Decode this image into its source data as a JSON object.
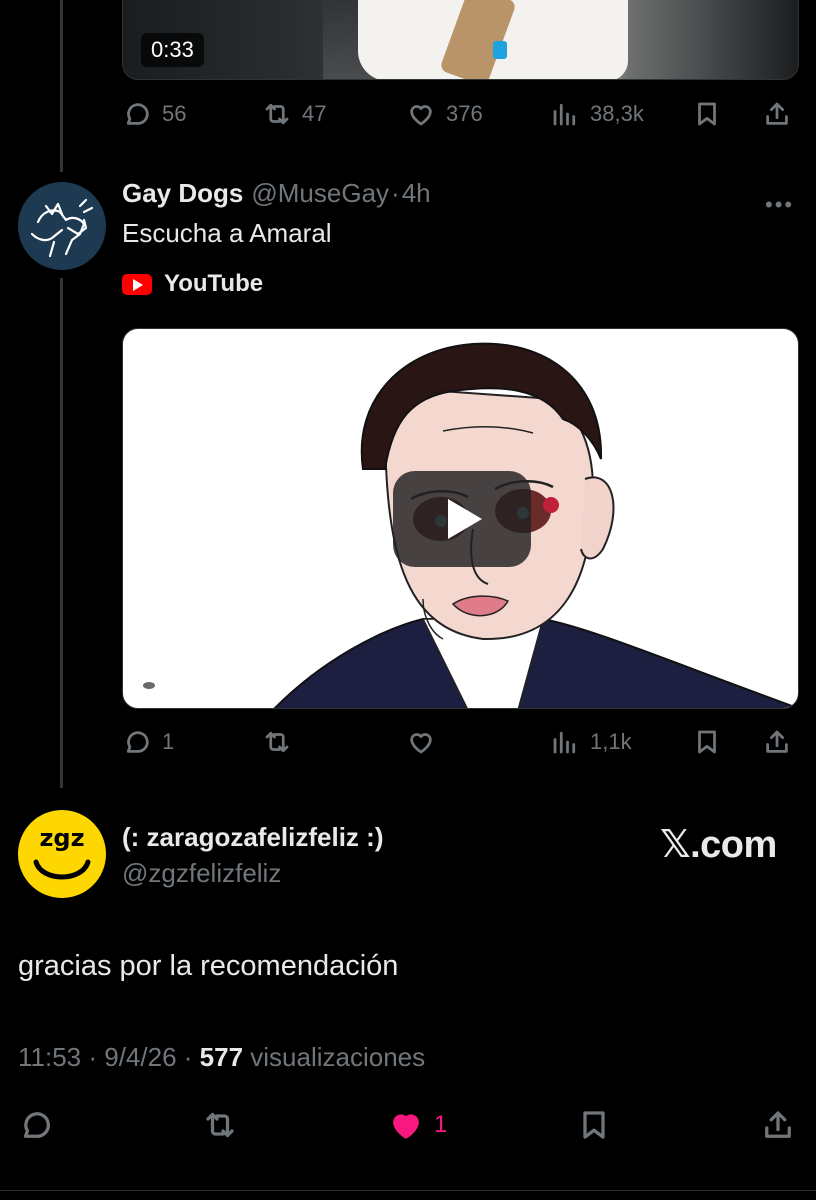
{
  "top_tweet": {
    "video_duration": "0:33",
    "replies": "56",
    "reposts": "47",
    "likes": "376",
    "views": "38,3k"
  },
  "reply_tweet": {
    "name": "Gay Dogs",
    "handle": "@MuseGay",
    "separator": "·",
    "time": "4h",
    "text": "Escucha a Amaral",
    "link_source": "YouTube",
    "replies": "1",
    "views": "1,1k"
  },
  "quote": {
    "avatar_text": "zgz",
    "name": "(: zaragozafelizfeliz :)",
    "handle": "@zgzfelizfeliz",
    "watermark": "𝕏.com",
    "text": "gracias por la recomendación",
    "time": "11:53",
    "date": "9/4/26",
    "views_count": "577",
    "views_label": "visualizaciones",
    "likes": "1"
  },
  "colors": {
    "background": "#000000",
    "text": "#e7e9ea",
    "muted": "#71767b",
    "like": "#f91880",
    "youtube": "#ff0000",
    "zgz_avatar": "#ffd700"
  },
  "icons": [
    "reply-icon",
    "repost-icon",
    "like-icon",
    "views-icon",
    "bookmark-icon",
    "share-icon",
    "more-icon",
    "youtube-icon",
    "play-icon"
  ]
}
